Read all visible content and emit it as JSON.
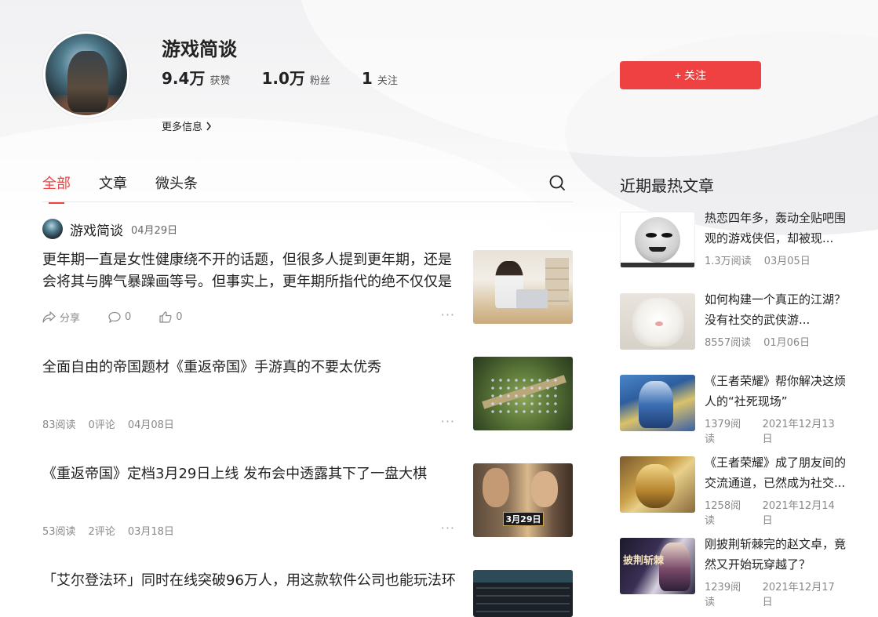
{
  "profile": {
    "name": "游戏简谈",
    "stats": [
      {
        "num": "9.4万",
        "label": "获赞"
      },
      {
        "num": "1.0万",
        "label": "粉丝"
      },
      {
        "num": "1",
        "label": "关注"
      }
    ],
    "more_info": "更多信息",
    "follow_label": "+ 关注"
  },
  "tabs": [
    "全部",
    "文章",
    "微头条"
  ],
  "feed": {
    "author": {
      "name": "游戏简谈",
      "date": "04月29日"
    },
    "post": {
      "text": "更年期一直是女性健康绕不开的话题，但很多人提到更年期，还是会将其与脾气暴躁画等号。但事实上，更年期所指代的绝不仅仅是",
      "share_label": "分享",
      "comments": "0",
      "likes": "0"
    },
    "articles": [
      {
        "title": "全面自由的帝国题材《重返帝国》手游真的不要太优秀",
        "reads": "83阅读",
        "comments": "0评论",
        "date": "04月08日"
      },
      {
        "title": "《重返帝国》定档3月29日上线 发布会中透露其下了一盘大棋",
        "reads": "53阅读",
        "comments": "2评论",
        "date": "03月18日",
        "thumb_badge": "3月29日"
      },
      {
        "title": "「艾尔登法环」同时在线突破96万人，用这款软件公司也能玩法环"
      }
    ],
    "more_dots": "···"
  },
  "sidebar": {
    "heading": "近期最热文章",
    "items": [
      {
        "title": "热恋四年多，轰动全贴吧围观的游戏侠侣，却被现...",
        "reads": "1.3万阅读",
        "date": "03月05日"
      },
      {
        "title": "如何构建一个真正的江湖？没有社交的武侠游...",
        "reads": "8557阅读",
        "date": "01月06日"
      },
      {
        "title": "《王者荣耀》帮你解决这烦人的“社死现场”",
        "reads": "1379阅读",
        "date": "2021年12月13日"
      },
      {
        "title": "《王者荣耀》成了朋友间的交流通道，已然成为社交...",
        "reads": "1258阅读",
        "date": "2021年12月14日"
      },
      {
        "title": "刚披荆斩棘完的赵文卓，竟然又开始玩穿越了？",
        "reads": "1239阅读",
        "date": "2021年12月17日",
        "thumb_text": "披荆斩棘"
      }
    ]
  },
  "colors": {
    "accent": "#f04142"
  }
}
